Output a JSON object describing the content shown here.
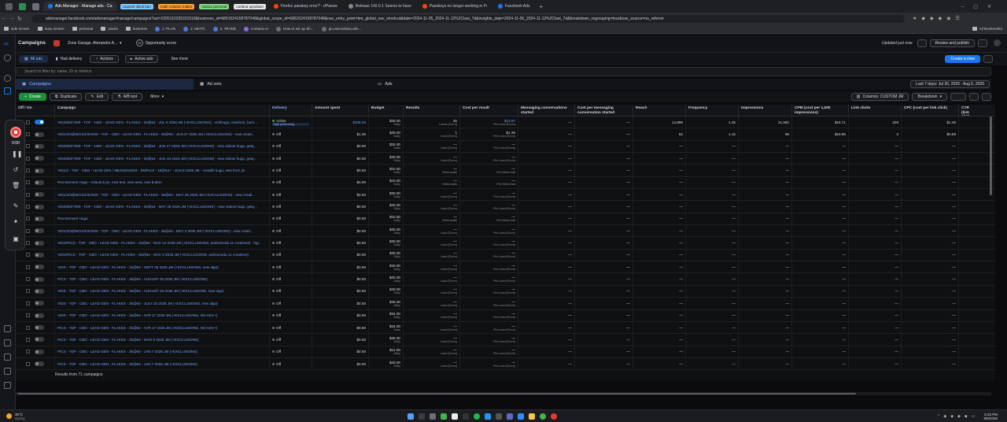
{
  "browser": {
    "tabs": [
      {
        "label": "Ads Manager - Manage ads - Ca",
        "active": true
      },
      {
        "label": "Firefox passkey error? : r/Passw",
        "active": false
      },
      {
        "label": "Release 142.0.1 Seems to have",
        "active": false
      },
      {
        "label": "Passkeys no longer working in Fi",
        "active": false
      },
      {
        "label": "Facebook Ads",
        "active": false
      }
    ],
    "pills": [
      {
        "label": "Utopreit tiktok ban",
        "color": "#7ec8ff"
      },
      {
        "label": "math solution maker",
        "color": "#ff9a3c"
      },
      {
        "label": "marias personal",
        "color": "#7fd67f"
      },
      {
        "label": "cortana upndown",
        "color": "#e6e6e6"
      }
    ],
    "url": "adsmanager.facebook.com/adsmanager/manage/campaigns?act=2205110335331518&business_id=6861524158787048&global_scope_id=6861524158787048&nav_entry_point=bm_global_nav_shortcut&date=2024-11-05_2024-11-12%2Clast_7d&insights_date=2024-11-05_2024-11-12%2Clast_7d&breakdown_regrouping=true&nav_source=no_referrer",
    "bookmarks": [
      "side screen",
      "main screen",
      "personal",
      "clocks",
      "business",
      "1. PLAN",
      "2. MKTG",
      "3. TRADE",
      "Cortana AI",
      "How to set up Sh...",
      "go.usecortana.ai/e..."
    ],
    "all_bookmarks": "All Bookmarks"
  },
  "topbar": {
    "title": "Campaigns",
    "account": "Zone Garage, Alexandre A...",
    "opportunity": "Opportunity score",
    "opportunity_value": "70",
    "updated": "Updated just now",
    "review_publish": "Review and publish"
  },
  "filters": {
    "all_ads": "All ads",
    "had_delivery": "Had delivery",
    "actions": "Actions",
    "active_ads": "Active ads",
    "see_more": "See more",
    "create_view": "Create a view"
  },
  "search": {
    "placeholder": "Search to filter by: name, ID or metrics"
  },
  "levels": {
    "campaigns": "Campaigns",
    "adsets": "Ad sets",
    "ads": "Ads"
  },
  "date_range": "Last 7 days: Jul 30, 2026 - Aug 5, 2026",
  "toolbar": {
    "create": "Create",
    "duplicate": "Duplicate",
    "edit": "Edit",
    "ab_test": "A/B test",
    "more": "More",
    "columns": "Columns: CUSTOM JM",
    "breakdown": "Breakdown"
  },
  "columns": [
    "Off / On",
    "Campaign",
    "Delivery",
    "Amount spent",
    "Budget",
    "Results",
    "Cost per result",
    "Messaging conversations started",
    "Cost per messaging conversation started",
    "Reach",
    "Frequency",
    "Impressions",
    "CPM (cost per 1,000 impressions)",
    "Link clicks",
    "CPC (cost per link click)",
    "CTR (link click-through rate)"
  ],
  "rows": [
    {
      "on": true,
      "name": "VID4/5/6/7/8/9 - TOF - CBO - LEAD GEN - FLAKES - 25@64 - JUL 5 2026 JM (+EXCLUSIONS) - vidshugo, newform, burn...",
      "delivery": "Active",
      "delivery_sub": "High performing",
      "spent": "$339.25",
      "budget": "$25.00",
      "budget_sub": "Daily",
      "results": "25",
      "results_sub": "Leads (Form)",
      "cpr": "$13.57",
      "cpr_sub": "Per Lead (Form)",
      "msg": "—",
      "cpm_msg": "—",
      "reach": "14,899",
      "freq": "1.45",
      "impr": "21,592",
      "cpm": "$15.71",
      "clicks": "229",
      "cpc": "$1.48"
    },
    {
      "on": false,
      "name": "VID1/2/3@MO1/2/3/4/5/6 - TOF - CBO - LEAD GEN - FLAKES - 25@64 - JUN 27 2026 JM (+EXCLUSIONS) - new creati...",
      "delivery": "Off",
      "delivery_sub": "",
      "spent": "$1.35",
      "budget": "$25.00",
      "budget_sub": "Daily",
      "results": "1",
      "results_sub": "Lead (Form)",
      "cpr": "$1.35",
      "cpr_sub": "Per Lead (Form)",
      "msg": "—",
      "cpm_msg": "—",
      "reach": "62",
      "freq": "1.10",
      "impr": "68",
      "cpm": "$19.85",
      "clicks": "2",
      "cpc": "$0.68"
    },
    {
      "on": false,
      "name": "VID4/5/6/7/8/9 - TOF - CBO - LEAD GEN - FLAKES - 25@64 - JUN 27 2026 JM (+EXCLUSIONS) - new videos hugo, getq...",
      "delivery": "Off",
      "delivery_sub": "",
      "spent": "$0.00",
      "budget": "$25.00",
      "budget_sub": "Daily",
      "results": "—",
      "results_sub": "Lead (Form)",
      "cpr": "—",
      "cpr_sub": "Per Lead (Form)",
      "msg": "—",
      "cpm_msg": "—",
      "reach": "—",
      "freq": "—",
      "impr": "—",
      "cpm": "—",
      "clicks": "—",
      "cpc": "—"
    },
    {
      "on": false,
      "name": "VID4/5/6/7/8/9 - TOF - CBO - LEAD GEN - FLAKES - 25@64 - JUN 16 2026 JM (+EXCLUSIONS) - new videos hugo, getq...",
      "delivery": "Off",
      "delivery_sub": "",
      "spent": "$0.00",
      "budget": "$40.00",
      "budget_sub": "Daily",
      "results": "—",
      "results_sub": "Lead (Form)",
      "cpr": "—",
      "cpr_sub": "Per Lead (Form)",
      "msg": "—",
      "cpm_msg": "—",
      "reach": "—",
      "freq": "—",
      "impr": "—",
      "cpm": "—",
      "clicks": "—",
      "cpc": "—"
    },
    {
      "on": false,
      "name": "VID1/2 - TOF - CBO - LEAD GEN / MESSENGER - EMPLOI - 18@64+ - JUN 8 2026 JM - creatifs hugo, new form jm",
      "delivery": "Off",
      "delivery_sub": "",
      "spent": "$0.00",
      "budget": "$10.00",
      "budget_sub": "Daily",
      "results": "—",
      "results_sub": "Meta leads",
      "cpr": "—",
      "cpr_sub": "Per Meta lead",
      "msg": "—",
      "cpm_msg": "—",
      "reach": "—",
      "freq": "—",
      "impr": "—",
      "cpm": "—",
      "clicks": "—",
      "cpc": "—"
    },
    {
      "on": false,
      "name": "Recrutement Hugo - relaunch jm, new text, new area, new button",
      "delivery": "Off",
      "delivery_sub": "",
      "spent": "$0.00",
      "budget": "$10.00",
      "budget_sub": "Daily",
      "results": "—",
      "results_sub": "Meta leads",
      "cpr": "—",
      "cpr_sub": "Per Meta lead",
      "msg": "—",
      "cpm_msg": "—",
      "reach": "—",
      "freq": "—",
      "impr": "—",
      "cpm": "—",
      "clicks": "—",
      "cpc": "—"
    },
    {
      "on": false,
      "name": "VID1/2/3@MO1/2/3/4/5/6 - TOF - CBO - LEAD GEN - FLAKES - 25@64 - MAY 28 2026 JM (+EXCLUSIONS) - new creati...",
      "delivery": "Off",
      "delivery_sub": "",
      "spent": "$0.00",
      "budget": "$30.00",
      "budget_sub": "Daily",
      "results": "—",
      "results_sub": "Lead (Form)",
      "cpr": "—",
      "cpr_sub": "Per Lead (Form)",
      "msg": "—",
      "cpm_msg": "—",
      "reach": "—",
      "freq": "—",
      "impr": "—",
      "cpm": "—",
      "clicks": "—",
      "cpc": "—"
    },
    {
      "on": false,
      "name": "VID4/5/6/7/8/9 - TOF - CBO - LEAD GEN - FLAKES - 25@64 - MAY 28 2026 JM (+EXCLUSIONS) - new videos hugo, getq...",
      "delivery": "Off",
      "delivery_sub": "",
      "spent": "$0.00",
      "budget": "$40.00",
      "budget_sub": "Daily",
      "results": "—",
      "results_sub": "Lead (Form)",
      "cpr": "—",
      "cpr_sub": "Per Lead (Form)",
      "msg": "—",
      "cpm_msg": "—",
      "reach": "—",
      "freq": "—",
      "impr": "—",
      "cpm": "—",
      "clicks": "—",
      "cpc": "—"
    },
    {
      "on": false,
      "name": "Recrutement Hugo",
      "delivery": "Off",
      "delivery_sub": "",
      "spent": "$0.00",
      "budget": "$10.00",
      "budget_sub": "Daily",
      "results": "—",
      "results_sub": "Meta leads",
      "cpr": "—",
      "cpr_sub": "Per Meta lead",
      "msg": "—",
      "cpm_msg": "—",
      "reach": "—",
      "freq": "—",
      "impr": "—",
      "cpm": "—",
      "clicks": "—",
      "cpc": "—"
    },
    {
      "on": false,
      "name": "VID1/2/3@MO1/2/3/4/5/6 - TOF - CBO - LEAD GEN - FLAKES - 25@64 - MAY 2 2026 JM (+EXCLUSIONS) - new creati...",
      "delivery": "Off",
      "delivery_sub": "",
      "spent": "$0.00",
      "budget": "$30.00",
      "budget_sub": "Daily",
      "results": "—",
      "results_sub": "Lead (Form)",
      "cpr": "—",
      "cpr_sub": "Per Lead (Form)",
      "msg": "—",
      "cpm_msg": "—",
      "reach": "—",
      "freq": "—",
      "impr": "—",
      "cpm": "—",
      "clicks": "—",
      "cpc": "—"
    },
    {
      "on": false,
      "name": "VIDS/PICS - TOF - CBO - LEAD GEN - FLAKES - 25@64 - NOV 12 2025 JM (+EXCLUSIONS, andromeda 11 creatives) - hig...",
      "delivery": "Off",
      "delivery_sub": "",
      "spent": "$0.00",
      "budget": "$30.00",
      "budget_sub": "Daily",
      "results": "—",
      "results_sub": "Lead (Form)",
      "cpr": "—",
      "cpr_sub": "Per Lead (Form)",
      "msg": "—",
      "cpm_msg": "—",
      "reach": "—",
      "freq": "—",
      "impr": "—",
      "cpm": "—",
      "clicks": "—",
      "cpc": "—"
    },
    {
      "on": false,
      "name": "VIDS/PICS - TOF - CBO - LEAD GEN - FLAKES - 25@64 - NOV 3 2025 JM (+EXCLUSIONS, andromeda 11 creatives)",
      "delivery": "Off",
      "delivery_sub": "",
      "spent": "$0.00",
      "budget": "$30.00",
      "budget_sub": "Daily",
      "results": "—",
      "results_sub": "Lead (Form)",
      "cpr": "—",
      "cpr_sub": "Per Lead (Form)",
      "msg": "—",
      "cpm_msg": "—",
      "reach": "—",
      "freq": "—",
      "impr": "—",
      "cpm": "—",
      "clicks": "—",
      "cpc": "—"
    },
    {
      "on": false,
      "name": "VIDS - TOF - CBO - LEAD GEN - FLAKES - 25@64 - SEPT 25 2025 JM (+EXCLUSIONS, new algo)",
      "delivery": "Off",
      "delivery_sub": "",
      "spent": "$0.00",
      "budget": "$40.00",
      "budget_sub": "Daily",
      "results": "—",
      "results_sub": "Lead (Form)",
      "cpr": "—",
      "cpr_sub": "Per Lead (Form)",
      "msg": "—",
      "cpm_msg": "—",
      "reach": "—",
      "freq": "—",
      "impr": "—",
      "cpm": "—",
      "clicks": "—",
      "cpc": "—"
    },
    {
      "on": false,
      "name": "PICS - TOF - CBO - LEAD GEN - FLAKES - 25@64 - AUGUST 28 2025 JM (+EXCLUSIONS)",
      "delivery": "Off",
      "delivery_sub": "",
      "spent": "$0.00",
      "budget": "$20.00",
      "budget_sub": "Daily",
      "results": "—",
      "results_sub": "Lead (Form)",
      "cpr": "—",
      "cpr_sub": "Per Lead (Form)",
      "msg": "—",
      "cpm_msg": "—",
      "reach": "—",
      "freq": "—",
      "impr": "—",
      "cpm": "—",
      "clicks": "—",
      "cpc": "—"
    },
    {
      "on": false,
      "name": "VIDS - TOF - CBO - LEAD GEN - FLAKES - 25@64 - AUGUST 28 2025 JM (+EXCLUSIONS, new algo)",
      "delivery": "Off",
      "delivery_sub": "",
      "spent": "$0.00",
      "budget": "$40.00",
      "budget_sub": "Daily",
      "results": "—",
      "results_sub": "Lead (Form)",
      "cpr": "—",
      "cpr_sub": "Per Lead (Form)",
      "msg": "—",
      "cpm_msg": "—",
      "reach": "—",
      "freq": "—",
      "impr": "—",
      "cpm": "—",
      "clicks": "—",
      "cpc": "—"
    },
    {
      "on": false,
      "name": "VIDS - TOF - CBO - LEAD GEN - FLAKES - 25@64 - JULY 23 2025 JM (+EXCLUSIONS, new algo)",
      "delivery": "Off",
      "delivery_sub": "",
      "spent": "$0.00",
      "budget": "$46.00",
      "budget_sub": "Daily",
      "results": "—",
      "results_sub": "Lead (Form)",
      "cpr": "—",
      "cpr_sub": "Per Lead (Form)",
      "msg": "—",
      "cpm_msg": "—",
      "reach": "—",
      "freq": "—",
      "impr": "—",
      "cpm": "—",
      "clicks": "—",
      "cpc": "—"
    },
    {
      "on": false,
      "name": "VIDS - TOF - CBO - LEAD GEN - FLAKES - 25@64 - AVR 17 2025 JM (+EXCLUSIONS, NO ADV+)",
      "delivery": "Off",
      "delivery_sub": "",
      "spent": "$0.00",
      "budget": "$34.00",
      "budget_sub": "Daily",
      "results": "—",
      "results_sub": "Lead (Form)",
      "cpr": "—",
      "cpr_sub": "Per Lead (Form)",
      "msg": "—",
      "cpm_msg": "—",
      "reach": "—",
      "freq": "—",
      "impr": "—",
      "cpm": "—",
      "clicks": "—",
      "cpc": "—"
    },
    {
      "on": false,
      "name": "PICS - TOF - CBO - LEAD GEN - FLAKES - 25@64 - AVR 17 2025 JM (+EXCLUSIONS, NO ADV+)",
      "delivery": "Off",
      "delivery_sub": "",
      "spent": "$0.00",
      "budget": "$34.00",
      "budget_sub": "Daily",
      "results": "—",
      "results_sub": "Lead (Form)",
      "cpr": "—",
      "cpr_sub": "Per Lead (Form)",
      "msg": "—",
      "cpm_msg": "—",
      "reach": "—",
      "freq": "—",
      "impr": "—",
      "cpm": "—",
      "clicks": "—",
      "cpc": "—"
    },
    {
      "on": false,
      "name": "PICS - TOF - CBO - LEAD GEN - FLAKES - 25@64 - MAR 9 2025 JM (+EXCLUSIONS)",
      "delivery": "Off",
      "delivery_sub": "",
      "spent": "$0.00",
      "budget": "$35.00",
      "budget_sub": "Daily",
      "results": "—",
      "results_sub": "Lead (Form)",
      "cpr": "—",
      "cpr_sub": "Per Lead (Form)",
      "msg": "—",
      "cpm_msg": "—",
      "reach": "—",
      "freq": "—",
      "impr": "—",
      "cpm": "—",
      "clicks": "—",
      "cpc": "—"
    },
    {
      "on": false,
      "name": "PICS - TOF - CBO - LEAD GEN - FLAKES - 25@64 - JAN 7 2025 JM (+EXCLUSIONS)",
      "delivery": "Off",
      "delivery_sub": "",
      "spent": "$0.00",
      "budget": "$12.00",
      "budget_sub": "Daily",
      "results": "—",
      "results_sub": "Lead (Form)",
      "cpr": "—",
      "cpr_sub": "Per Lead (Form)",
      "msg": "—",
      "cpm_msg": "—",
      "reach": "—",
      "freq": "—",
      "impr": "—",
      "cpm": "—",
      "clicks": "—",
      "cpc": "—"
    },
    {
      "on": false,
      "name": "PICS - TOF - CBO - LEAD GEN - FLAKES - 25@64 - JAN 7 2025 JM (+EXCLUSIONS)",
      "delivery": "Off",
      "delivery_sub": "",
      "spent": "$0.00",
      "budget": "$40.00",
      "budget_sub": "Daily",
      "results": "—",
      "results_sub": "Lead (Form)",
      "cpr": "—",
      "cpr_sub": "Per Lead (Form)",
      "msg": "—",
      "cpm_msg": "—",
      "reach": "—",
      "freq": "—",
      "impr": "—",
      "cpm": "—",
      "clicks": "—",
      "cpc": "—"
    }
  ],
  "footer": {
    "results_label": "Results from 71 campaigns"
  },
  "recorder": {
    "time": "0:00"
  },
  "taskbar": {
    "weather_temp": "30°C",
    "weather_desc": "Sunny",
    "time": "5:33 PM",
    "date": "8/6/2026"
  },
  "colors": {
    "accent": "#1877f2",
    "link": "#6ea2ff",
    "active_green": "#31a24c",
    "record_red": "#e53935"
  }
}
